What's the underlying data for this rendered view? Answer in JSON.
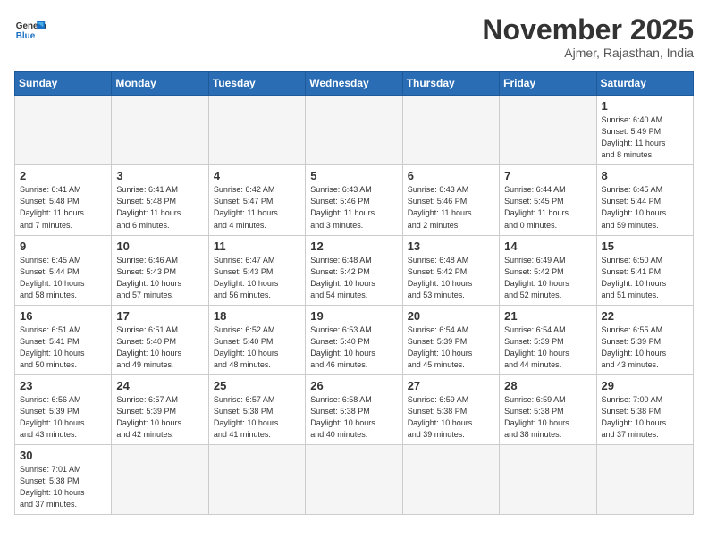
{
  "header": {
    "logo_general": "General",
    "logo_blue": "Blue",
    "month_year": "November 2025",
    "location": "Ajmer, Rajasthan, India"
  },
  "weekdays": [
    "Sunday",
    "Monday",
    "Tuesday",
    "Wednesday",
    "Thursday",
    "Friday",
    "Saturday"
  ],
  "weeks": [
    [
      {
        "day": "",
        "info": ""
      },
      {
        "day": "",
        "info": ""
      },
      {
        "day": "",
        "info": ""
      },
      {
        "day": "",
        "info": ""
      },
      {
        "day": "",
        "info": ""
      },
      {
        "day": "",
        "info": ""
      },
      {
        "day": "1",
        "info": "Sunrise: 6:40 AM\nSunset: 5:49 PM\nDaylight: 11 hours\nand 8 minutes."
      }
    ],
    [
      {
        "day": "2",
        "info": "Sunrise: 6:41 AM\nSunset: 5:48 PM\nDaylight: 11 hours\nand 7 minutes."
      },
      {
        "day": "3",
        "info": "Sunrise: 6:41 AM\nSunset: 5:48 PM\nDaylight: 11 hours\nand 6 minutes."
      },
      {
        "day": "4",
        "info": "Sunrise: 6:42 AM\nSunset: 5:47 PM\nDaylight: 11 hours\nand 4 minutes."
      },
      {
        "day": "5",
        "info": "Sunrise: 6:43 AM\nSunset: 5:46 PM\nDaylight: 11 hours\nand 3 minutes."
      },
      {
        "day": "6",
        "info": "Sunrise: 6:43 AM\nSunset: 5:46 PM\nDaylight: 11 hours\nand 2 minutes."
      },
      {
        "day": "7",
        "info": "Sunrise: 6:44 AM\nSunset: 5:45 PM\nDaylight: 11 hours\nand 0 minutes."
      },
      {
        "day": "8",
        "info": "Sunrise: 6:45 AM\nSunset: 5:44 PM\nDaylight: 10 hours\nand 59 minutes."
      }
    ],
    [
      {
        "day": "9",
        "info": "Sunrise: 6:45 AM\nSunset: 5:44 PM\nDaylight: 10 hours\nand 58 minutes."
      },
      {
        "day": "10",
        "info": "Sunrise: 6:46 AM\nSunset: 5:43 PM\nDaylight: 10 hours\nand 57 minutes."
      },
      {
        "day": "11",
        "info": "Sunrise: 6:47 AM\nSunset: 5:43 PM\nDaylight: 10 hours\nand 56 minutes."
      },
      {
        "day": "12",
        "info": "Sunrise: 6:48 AM\nSunset: 5:42 PM\nDaylight: 10 hours\nand 54 minutes."
      },
      {
        "day": "13",
        "info": "Sunrise: 6:48 AM\nSunset: 5:42 PM\nDaylight: 10 hours\nand 53 minutes."
      },
      {
        "day": "14",
        "info": "Sunrise: 6:49 AM\nSunset: 5:42 PM\nDaylight: 10 hours\nand 52 minutes."
      },
      {
        "day": "15",
        "info": "Sunrise: 6:50 AM\nSunset: 5:41 PM\nDaylight: 10 hours\nand 51 minutes."
      }
    ],
    [
      {
        "day": "16",
        "info": "Sunrise: 6:51 AM\nSunset: 5:41 PM\nDaylight: 10 hours\nand 50 minutes."
      },
      {
        "day": "17",
        "info": "Sunrise: 6:51 AM\nSunset: 5:40 PM\nDaylight: 10 hours\nand 49 minutes."
      },
      {
        "day": "18",
        "info": "Sunrise: 6:52 AM\nSunset: 5:40 PM\nDaylight: 10 hours\nand 48 minutes."
      },
      {
        "day": "19",
        "info": "Sunrise: 6:53 AM\nSunset: 5:40 PM\nDaylight: 10 hours\nand 46 minutes."
      },
      {
        "day": "20",
        "info": "Sunrise: 6:54 AM\nSunset: 5:39 PM\nDaylight: 10 hours\nand 45 minutes."
      },
      {
        "day": "21",
        "info": "Sunrise: 6:54 AM\nSunset: 5:39 PM\nDaylight: 10 hours\nand 44 minutes."
      },
      {
        "day": "22",
        "info": "Sunrise: 6:55 AM\nSunset: 5:39 PM\nDaylight: 10 hours\nand 43 minutes."
      }
    ],
    [
      {
        "day": "23",
        "info": "Sunrise: 6:56 AM\nSunset: 5:39 PM\nDaylight: 10 hours\nand 43 minutes."
      },
      {
        "day": "24",
        "info": "Sunrise: 6:57 AM\nSunset: 5:39 PM\nDaylight: 10 hours\nand 42 minutes."
      },
      {
        "day": "25",
        "info": "Sunrise: 6:57 AM\nSunset: 5:38 PM\nDaylight: 10 hours\nand 41 minutes."
      },
      {
        "day": "26",
        "info": "Sunrise: 6:58 AM\nSunset: 5:38 PM\nDaylight: 10 hours\nand 40 minutes."
      },
      {
        "day": "27",
        "info": "Sunrise: 6:59 AM\nSunset: 5:38 PM\nDaylight: 10 hours\nand 39 minutes."
      },
      {
        "day": "28",
        "info": "Sunrise: 6:59 AM\nSunset: 5:38 PM\nDaylight: 10 hours\nand 38 minutes."
      },
      {
        "day": "29",
        "info": "Sunrise: 7:00 AM\nSunset: 5:38 PM\nDaylight: 10 hours\nand 37 minutes."
      }
    ],
    [
      {
        "day": "30",
        "info": "Sunrise: 7:01 AM\nSunset: 5:38 PM\nDaylight: 10 hours\nand 37 minutes."
      },
      {
        "day": "",
        "info": ""
      },
      {
        "day": "",
        "info": ""
      },
      {
        "day": "",
        "info": ""
      },
      {
        "day": "",
        "info": ""
      },
      {
        "day": "",
        "info": ""
      },
      {
        "day": "",
        "info": ""
      }
    ]
  ]
}
